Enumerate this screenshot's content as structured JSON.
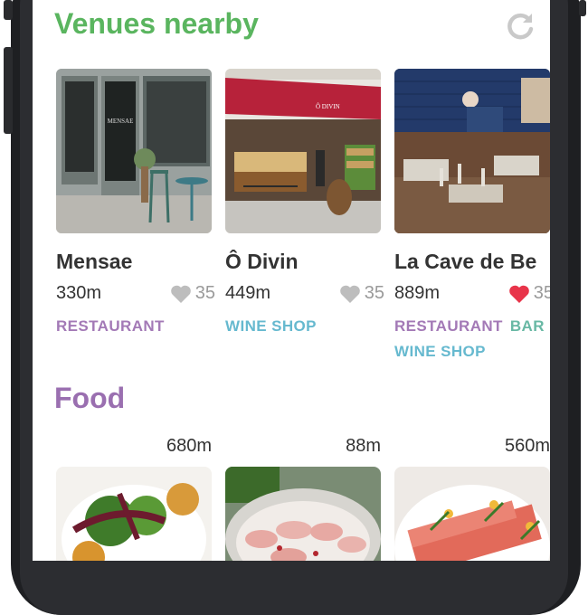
{
  "colors": {
    "venues_title": "#5ab55f",
    "food_title": "#9a6fb0",
    "heart_inactive": "#bdbdbd",
    "heart_active": "#e8344a",
    "tag_restaurant": "#a379b6",
    "tag_wine_shop": "#66b9cf",
    "tag_bar": "#68b8a4"
  },
  "venues": {
    "title": "Venues nearby",
    "refresh_icon": "refresh-icon",
    "items": [
      {
        "name": "Mensae",
        "distance": "330m",
        "likes": "35",
        "liked": false,
        "tags": [
          "RESTAURANT"
        ]
      },
      {
        "name": "Ô Divin",
        "distance": "449m",
        "likes": "35",
        "liked": false,
        "tags": [
          "WINE SHOP"
        ]
      },
      {
        "name": "La Cave de Be",
        "distance": "889m",
        "likes": "35",
        "liked": true,
        "tags": [
          "RESTAURANT",
          "BAR",
          "WINE SHOP"
        ]
      }
    ]
  },
  "food": {
    "title": "Food",
    "items": [
      {
        "distance": "680m"
      },
      {
        "distance": "88m"
      },
      {
        "distance": "560m"
      }
    ]
  }
}
